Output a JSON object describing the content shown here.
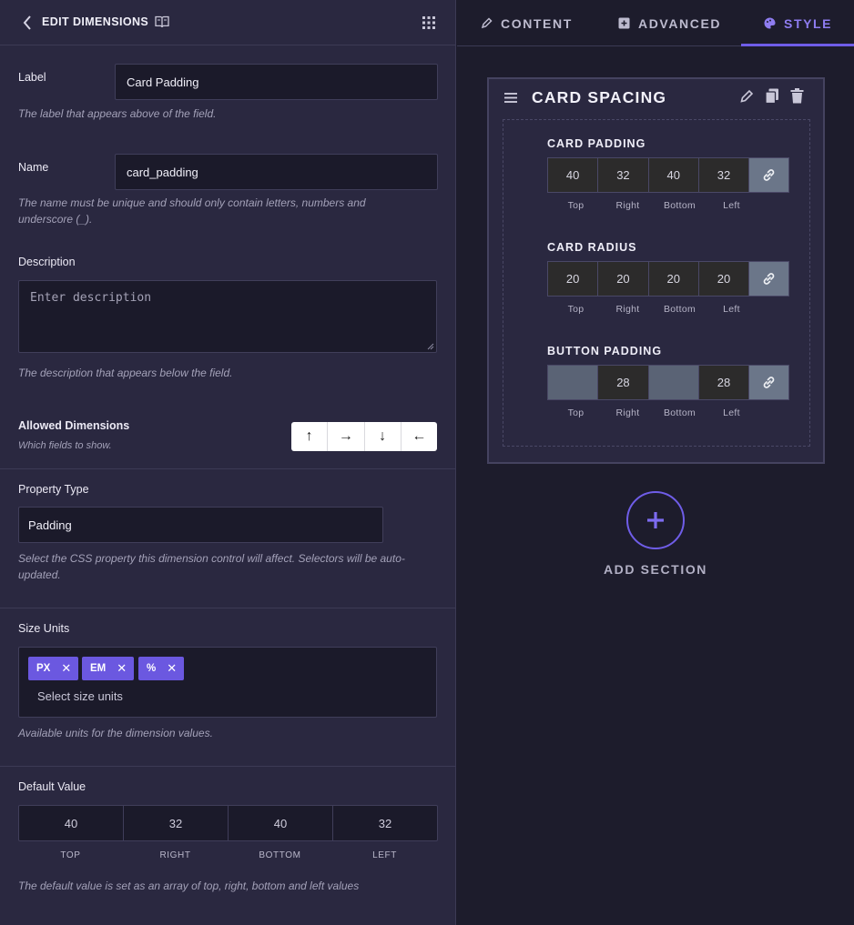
{
  "header": {
    "title": "EDIT DIMENSIONS"
  },
  "label_field": {
    "label": "Label",
    "value": "Card Padding",
    "help": "The label that appears above of the field."
  },
  "name_field": {
    "label": "Name",
    "value": "card_padding",
    "help": "The name must be unique and should only contain letters, numbers and underscore (_)."
  },
  "description_field": {
    "label": "Description",
    "placeholder": "Enter description",
    "help": "The description that appears below the field."
  },
  "allowed_dimensions": {
    "label": "Allowed Dimensions",
    "sub": "Which fields to show.",
    "buttons": [
      "↑",
      "→",
      "↓",
      "←"
    ]
  },
  "property_type": {
    "label": "Property Type",
    "value": "Padding",
    "help": "Select the CSS property this dimension control will affect. Selectors will be auto-updated."
  },
  "size_units": {
    "label": "Size Units",
    "tags": [
      "PX",
      "EM",
      "%"
    ],
    "remove_glyph": "✕",
    "placeholder": "Select size units",
    "help": "Available units for the dimension values."
  },
  "default_value": {
    "label": "Default Value",
    "values": [
      "40",
      "32",
      "40",
      "32"
    ],
    "labels": [
      "TOP",
      "RIGHT",
      "BOTTOM",
      "LEFT"
    ],
    "help": "The default value is set as an array of top, right, bottom and left values"
  },
  "tabs": [
    {
      "label": "CONTENT",
      "icon": "pencil-icon"
    },
    {
      "label": "ADVANCED",
      "icon": "plus-square-icon"
    },
    {
      "label": "STYLE",
      "icon": "palette-icon",
      "active": true
    }
  ],
  "section": {
    "title": "CARD SPACING",
    "side_labels": [
      "Top",
      "Right",
      "Bottom",
      "Left"
    ],
    "controls": [
      {
        "title": "CARD PADDING",
        "values": [
          "40",
          "32",
          "40",
          "32"
        ]
      },
      {
        "title": "CARD RADIUS",
        "values": [
          "20",
          "20",
          "20",
          "20"
        ]
      },
      {
        "title": "BUTTON PADDING",
        "values": [
          "",
          "28",
          "",
          "28"
        ]
      }
    ]
  },
  "add_section": {
    "label": "ADD SECTION"
  },
  "colors": {
    "accent": "#6f5de8",
    "panel": "#2a2840",
    "background": "#1d1c2c",
    "link_button": "#6b7689"
  }
}
